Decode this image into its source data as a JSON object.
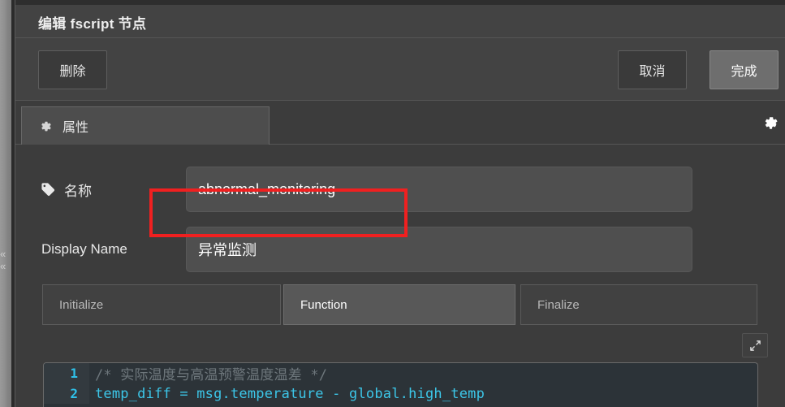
{
  "dialog": {
    "title": "编辑 fscript 节点",
    "toolbar": {
      "delete_label": "删除",
      "cancel_label": "取消",
      "done_label": "完成"
    },
    "tabs": {
      "properties_label": "属性",
      "properties_icon": "gear-icon",
      "settings_icon": "gear-icon"
    }
  },
  "form": {
    "name_field": {
      "label": "名称",
      "icon": "tag-icon",
      "value": "abnormal_monitoring",
      "placeholder": "Name"
    },
    "display_name_field": {
      "label": "Display Name",
      "value": "异常监测",
      "placeholder": "Display Name"
    }
  },
  "script_tabs": [
    {
      "label": "Initialize",
      "active": false
    },
    {
      "label": "Function",
      "active": true
    },
    {
      "label": "Finalize",
      "active": false
    }
  ],
  "editor": {
    "expand_icon": "expand-icon",
    "lines": [
      {
        "num": "1",
        "text": "/* 实际温度与高温预警温度温差 */",
        "kind": "comment"
      },
      {
        "num": "2",
        "text": "temp_diff = msg.temperature - global.high_temp",
        "kind": "code"
      }
    ]
  },
  "canvas": {
    "collapse_icon": "chevron-left-icon"
  },
  "colors": {
    "highlight": "#f02020",
    "dialog_bg": "#3c3c3c",
    "accent_code": "#3cc6e8"
  }
}
